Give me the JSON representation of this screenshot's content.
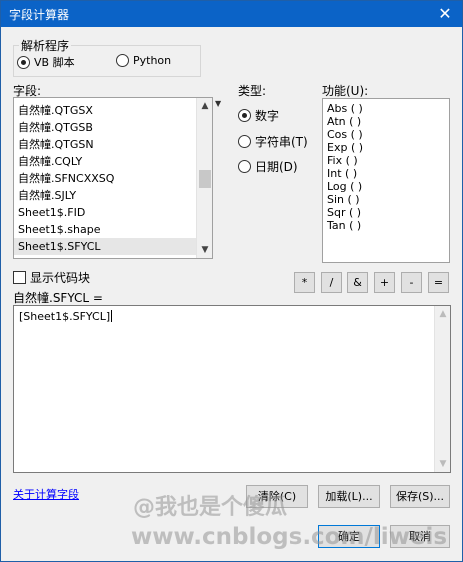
{
  "window": {
    "title": "字段计算器",
    "close_glyph": "✕"
  },
  "parser": {
    "label": "解析程序",
    "options": [
      {
        "label": "VB 脚本",
        "selected": true
      },
      {
        "label": "Python",
        "selected": false
      }
    ]
  },
  "fields": {
    "label": "字段:",
    "items": [
      "自然幢.QTGSX",
      "自然幢.QTGSB",
      "自然幢.QTGSN",
      "自然幢.CQLY",
      "自然幢.SFNCXXSQ",
      "自然幢.SJLY",
      "Sheet1$.FID",
      "Sheet1$.shape",
      "Sheet1$.SFYCL"
    ]
  },
  "type": {
    "label": "类型:",
    "options": [
      {
        "label": "数字",
        "selected": true
      },
      {
        "label": "字符串(T)",
        "selected": false
      },
      {
        "label": "日期(D)",
        "selected": false
      }
    ]
  },
  "functions": {
    "label": "功能(U):",
    "items": [
      "Abs ( )",
      "Atn ( )",
      "Cos ( )",
      "Exp ( )",
      "Fix ( )",
      "Int ( )",
      "Log ( )",
      "Sin ( )",
      "Sqr ( )",
      "Tan ( )"
    ]
  },
  "show_codeblock": {
    "label": "显示代码块",
    "checked": false
  },
  "operators": [
    "*",
    "/",
    "&",
    "+",
    "-",
    "="
  ],
  "expression": {
    "label": "自然幢.SFYCL =",
    "value": "[Sheet1$.SFYCL]"
  },
  "about_link": "关于计算字段",
  "buttons": {
    "clear": "清除(C)",
    "load": "加载(L)...",
    "save": "保存(S)...",
    "ok": "确定",
    "cancel": "取消"
  },
  "watermark": {
    "line1": "@我也是个傻瓜",
    "line2": "www.cnblogs.com/liweis"
  }
}
